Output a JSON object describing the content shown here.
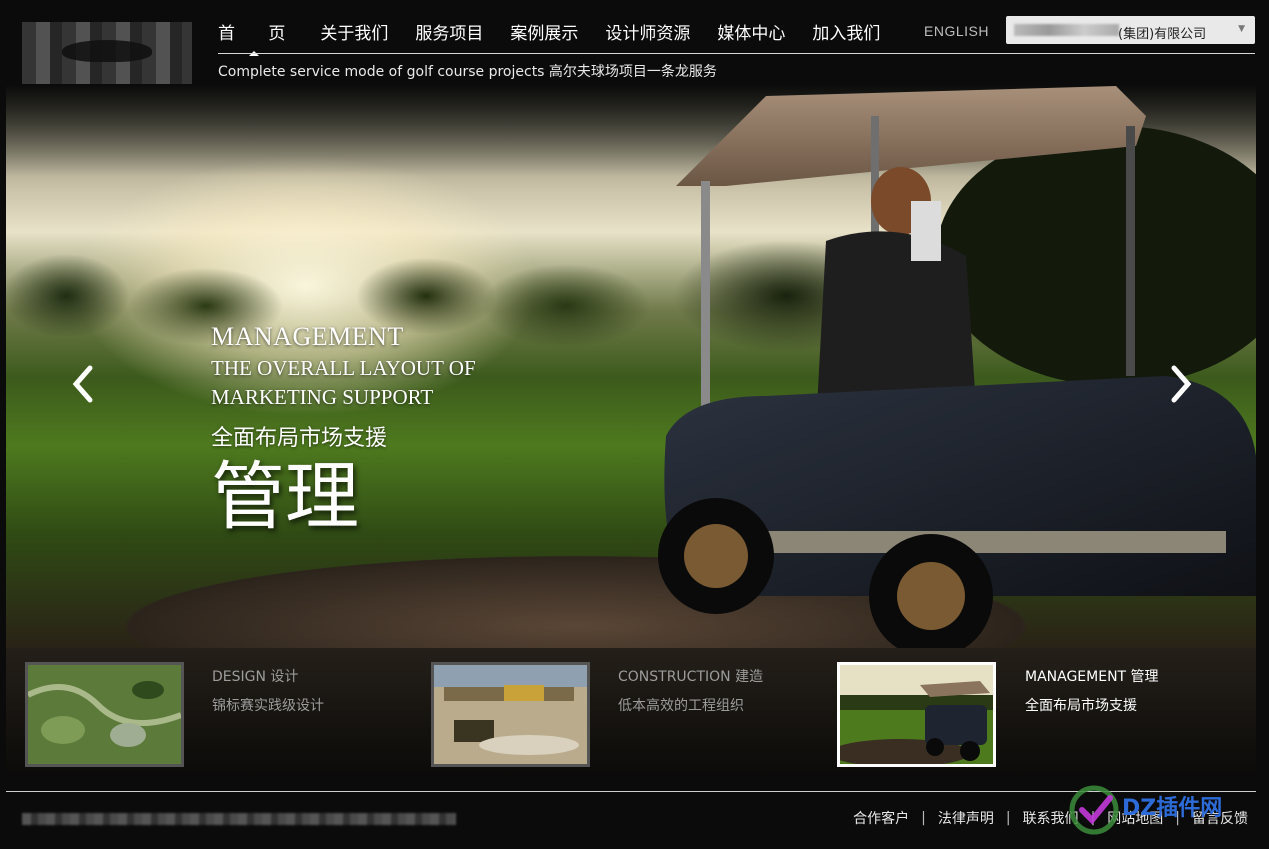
{
  "header": {
    "nav": [
      {
        "label": "首  页",
        "active": true
      },
      {
        "label": "关于我们"
      },
      {
        "label": "服务项目"
      },
      {
        "label": "案例展示"
      },
      {
        "label": "设计师资源"
      },
      {
        "label": "媒体中心"
      },
      {
        "label": "加入我们"
      }
    ],
    "english_label": "ENGLISH",
    "company_select_value": "(集团)有限公司",
    "tagline": "Complete service mode of golf course projects 高尔夫球场项目一条龙服务"
  },
  "hero": {
    "line1": "MANAGEMENT",
    "line2": "THE OVERALL LAYOUT OF",
    "line3": "MARKETING SUPPORT",
    "subtitle_cn": "全面布局市场支援",
    "title_cn": "管理"
  },
  "slides": [
    {
      "title": "DESIGN 设计",
      "subtitle": "锦标赛实践级设计",
      "active": false
    },
    {
      "title": "CONSTRUCTION 建造",
      "subtitle": "低本高效的工程组织",
      "active": false
    },
    {
      "title": "MANAGEMENT 管理",
      "subtitle": "全面布局市场支援",
      "active": true
    }
  ],
  "footer": {
    "links": [
      "合作客户",
      "法律声明",
      "联系我们",
      "网站地图",
      "留言反馈"
    ]
  },
  "watermark": {
    "text": "DZ插件网"
  },
  "colors": {
    "background": "#0b0b0b",
    "accent_watermark": "#2d6bd8"
  }
}
